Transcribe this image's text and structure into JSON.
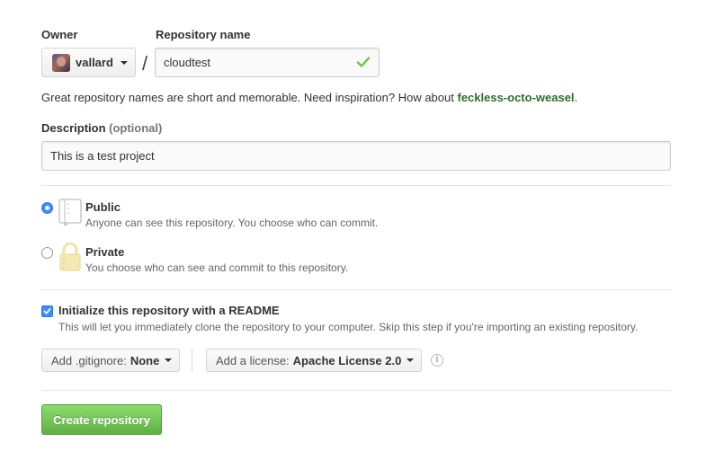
{
  "owner": {
    "label": "Owner",
    "value": "vallard"
  },
  "repo": {
    "label": "Repository name",
    "value": "cloudtest",
    "separator": "/"
  },
  "hint": {
    "text": "Great repository names are short and memorable. Need inspiration? How about",
    "suggestion": "feckless-octo-weasel",
    "end": "."
  },
  "description": {
    "label": "Description",
    "optional": "(optional)",
    "value": "This is a test project"
  },
  "visibility": {
    "public": {
      "title": "Public",
      "desc": "Anyone can see this repository. You choose who can commit.",
      "checked": true
    },
    "private": {
      "title": "Private",
      "desc": "You choose who can see and commit to this repository.",
      "checked": false
    }
  },
  "readme": {
    "title": "Initialize this repository with a README",
    "desc": "This will let you immediately clone the repository to your computer. Skip this step if you're importing an existing repository.",
    "checked": true
  },
  "gitignore": {
    "label": "Add .gitignore:",
    "value": "None"
  },
  "license": {
    "label": "Add a license:",
    "value": "Apache License 2.0"
  },
  "submit": {
    "label": "Create repository"
  },
  "colors": {
    "accent": "#3d8ef5",
    "success": "#6cc644",
    "suggestion": "#2b6e2b"
  },
  "icons": {
    "check": "check-icon",
    "repo": "repo-book-icon",
    "lock": "lock-icon",
    "info": "info-icon"
  }
}
